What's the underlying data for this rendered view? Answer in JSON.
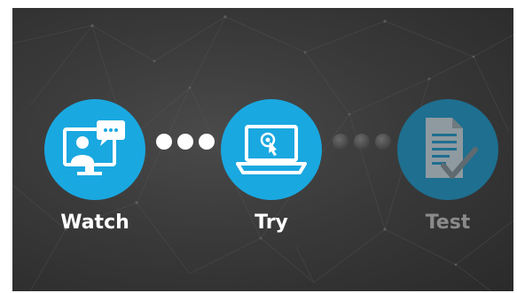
{
  "steps": [
    {
      "label": "Watch",
      "state": "active",
      "icon": "video-chat-monitor-icon",
      "circle_color": "#1aa8e0",
      "label_color": "#ffffff"
    },
    {
      "label": "Try",
      "state": "active",
      "icon": "laptop-cursor-icon",
      "circle_color": "#1aa8e0",
      "label_color": "#ffffff"
    },
    {
      "label": "Test",
      "state": "inactive",
      "icon": "checklist-document-icon",
      "circle_color": "#1e6f90",
      "label_color": "#8a8a8a"
    }
  ],
  "connectors": [
    {
      "state": "active",
      "dot_color": "#ffffff"
    },
    {
      "state": "inactive",
      "dot_color": "#4a4a4a"
    }
  ],
  "colors": {
    "background": "#3a3a3a",
    "accent": "#1aa8e0"
  }
}
